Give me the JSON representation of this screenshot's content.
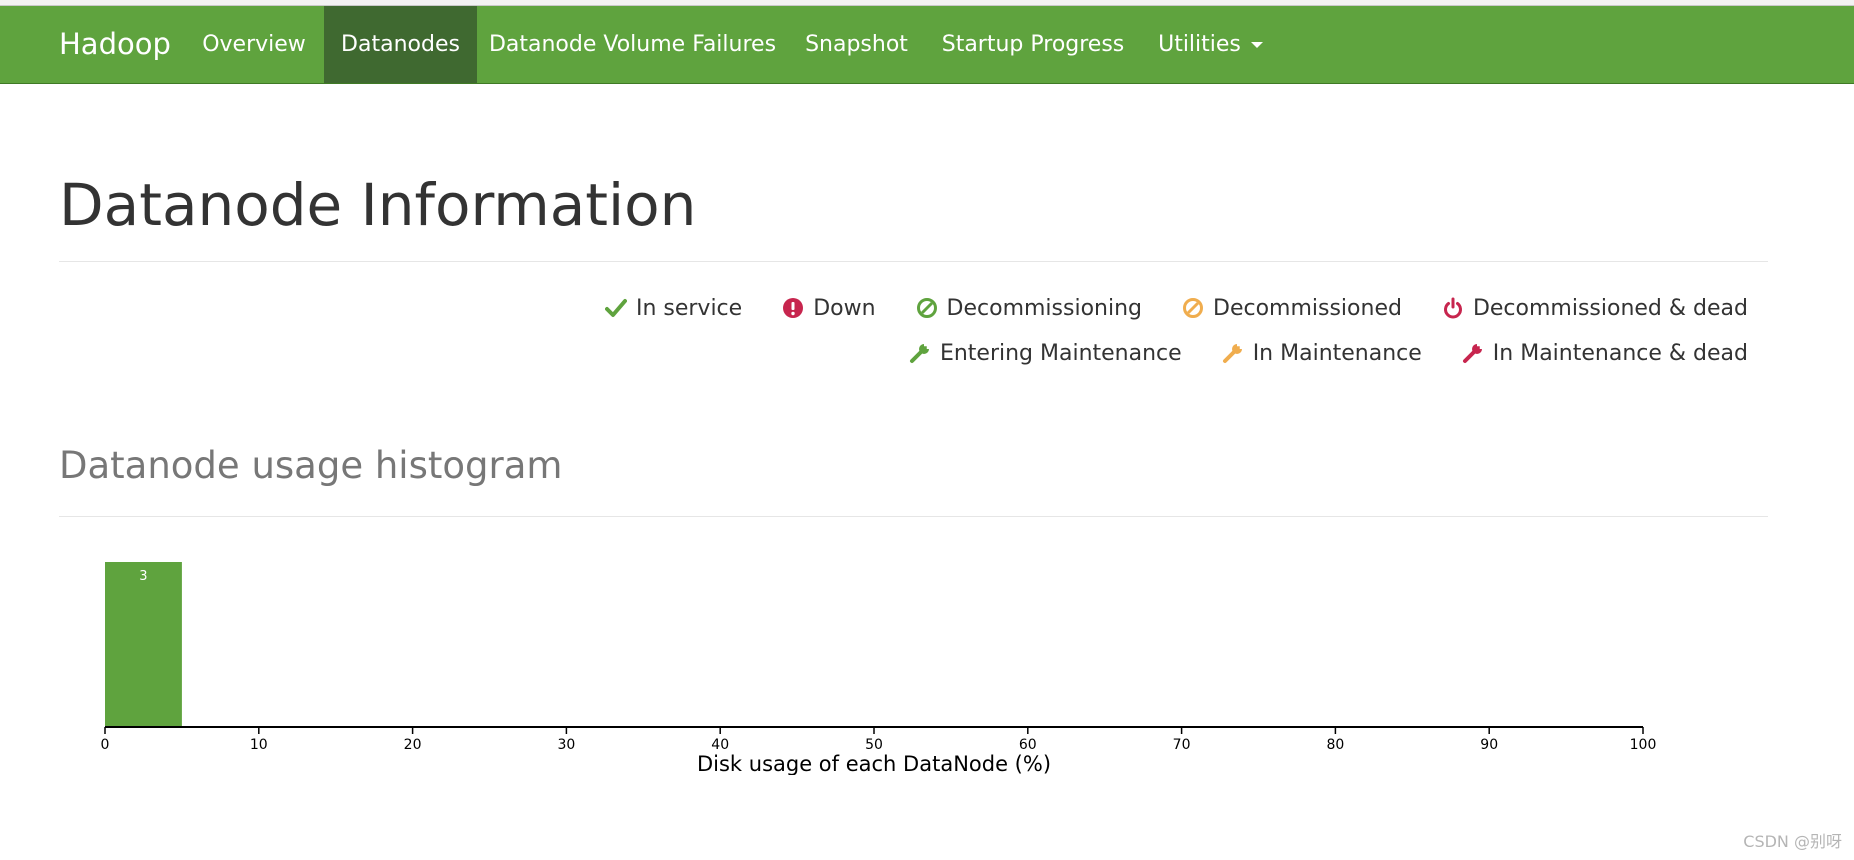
{
  "navbar": {
    "brand": "Hadoop",
    "items": [
      {
        "label": "Overview"
      },
      {
        "label": "Datanodes"
      },
      {
        "label": "Datanode Volume Failures"
      },
      {
        "label": "Snapshot"
      },
      {
        "label": "Startup Progress"
      },
      {
        "label": "Utilities"
      }
    ],
    "active": "Datanodes",
    "color": "#5fa33e",
    "active_color": "#3f6930"
  },
  "page": {
    "title": "Datanode Information",
    "histogram_title": "Datanode usage histogram"
  },
  "legend": {
    "row1": [
      {
        "label": "In service",
        "icon": "check-icon",
        "color": "#5fa33e"
      },
      {
        "label": "Down",
        "icon": "exclamation-circle-icon",
        "color": "#c7254e"
      },
      {
        "label": "Decommissioning",
        "icon": "ban-icon",
        "color": "#5fa33e"
      },
      {
        "label": "Decommissioned",
        "icon": "ban-icon",
        "color": "#f0ad4e"
      },
      {
        "label": "Decommissioned & dead",
        "icon": "power-off-icon",
        "color": "#c7254e"
      }
    ],
    "row2": [
      {
        "label": "Entering Maintenance",
        "icon": "wrench-icon",
        "color": "#5fa33e"
      },
      {
        "label": "In Maintenance",
        "icon": "wrench-icon",
        "color": "#f0ad4e"
      },
      {
        "label": "In Maintenance & dead",
        "icon": "wrench-icon",
        "color": "#c7254e"
      }
    ]
  },
  "chart_data": {
    "type": "bar",
    "bins": [
      {
        "x0": 0,
        "x1": 5,
        "count": 3
      }
    ],
    "xlabel": "Disk usage of each DataNode (%)",
    "ylabel": "",
    "xlim": [
      0,
      100
    ],
    "xticks": [
      0,
      10,
      20,
      30,
      40,
      50,
      60,
      70,
      80,
      90,
      100
    ],
    "bar_color": "#5fa33e",
    "grid": false
  },
  "watermark": "CSDN @别呀"
}
